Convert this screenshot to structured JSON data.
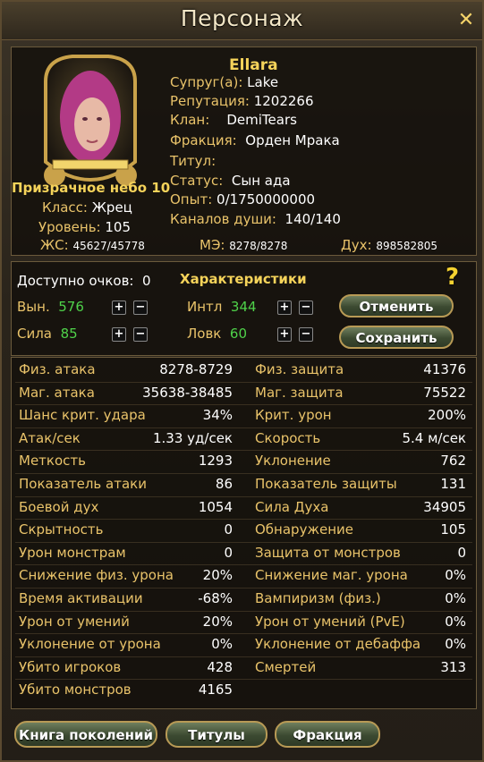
{
  "window": {
    "title": "Персонаж",
    "close_icon": "close-icon"
  },
  "profile": {
    "name": "Ellara",
    "nickname": "Призрачное небо 10",
    "fields": [
      {
        "label": "Супруг(а):",
        "value": "Lake"
      },
      {
        "label": "Репутация:",
        "value": "1202266"
      },
      {
        "label": "Клан:",
        "value": "DemiTears"
      },
      {
        "label": "Фракция:",
        "value": "Орден Мрака"
      },
      {
        "label": "Титул:",
        "value": ""
      },
      {
        "label": "Статус:",
        "value": "Сын ада"
      },
      {
        "label": "Опыт:",
        "value": "0/1750000000"
      },
      {
        "label": "Каналов души:",
        "value": "140/140"
      }
    ],
    "class_label": "Класс:",
    "class_value": "Жрец",
    "level_label": "Уровень:",
    "level_value": "105",
    "hp_label": "ЖС:",
    "hp_value": "45627/45778",
    "mp_label": "МЭ:",
    "mp_value": "8278/8278",
    "spirit_label": "Дух:",
    "spirit_value": "898582805"
  },
  "points": {
    "available_label": "Доступно очков:",
    "available_value": "0",
    "heading": "Характеристики",
    "stats": [
      {
        "label": "Вын.",
        "value": "576"
      },
      {
        "label": "Интл",
        "value": "344"
      },
      {
        "label": "Сила",
        "value": "85"
      },
      {
        "label": "Ловк",
        "value": "60"
      }
    ],
    "plus": "+",
    "minus": "−",
    "cancel_label": "Отменить",
    "save_label": "Сохранить"
  },
  "attributes": {
    "left": [
      {
        "label": "Физ. атака",
        "value": "8278-8729"
      },
      {
        "label": "Маг. атака",
        "value": "35638-38485"
      },
      {
        "label": "Шанс крит. удара",
        "value": "34%"
      },
      {
        "label": "Атак/сек",
        "value": "1.33 уд/сек"
      },
      {
        "label": "Меткость",
        "value": "1293"
      },
      {
        "label": "Показатель атаки",
        "value": "86"
      },
      {
        "label": "Боевой дух",
        "value": "1054"
      },
      {
        "label": "Скрытность",
        "value": "0"
      },
      {
        "label": "Урон монстрам",
        "value": "0"
      },
      {
        "label": "Снижение физ. урона",
        "value": "20%"
      },
      {
        "label": "Время активации",
        "value": "-68%"
      },
      {
        "label": "Урон от умений",
        "value": "20%"
      },
      {
        "label": "Уклонение от урона",
        "value": "0%"
      },
      {
        "label": "Убито игроков",
        "value": "428"
      },
      {
        "label": "Убито монстров",
        "value": "4165"
      }
    ],
    "right": [
      {
        "label": "Физ. защита",
        "value": "41376"
      },
      {
        "label": "Маг. защита",
        "value": "75522"
      },
      {
        "label": "Крит. урон",
        "value": "200%"
      },
      {
        "label": "Скорость",
        "value": "5.4 м/сек"
      },
      {
        "label": "Уклонение",
        "value": "762"
      },
      {
        "label": "Показатель защиты",
        "value": "131"
      },
      {
        "label": "Сила Духа",
        "value": "34905"
      },
      {
        "label": "Обнаружение",
        "value": "105"
      },
      {
        "label": "Защита от монстров",
        "value": "0"
      },
      {
        "label": "Снижение маг. урона",
        "value": "0%"
      },
      {
        "label": "Вампиризм (физ.)",
        "value": "0%"
      },
      {
        "label": "Урон от умений (PvE)",
        "value": "0%"
      },
      {
        "label": "Уклонение от дебаффа",
        "value": "0%"
      },
      {
        "label": "Смертей",
        "value": "313"
      }
    ]
  },
  "footer": {
    "generations_label": "Книга поколений",
    "titles_label": "Титулы",
    "faction_label": "Фракция"
  },
  "colors": {
    "accent": "#e9c36a",
    "gold": "#f5d35a",
    "green": "#4fd24a"
  }
}
